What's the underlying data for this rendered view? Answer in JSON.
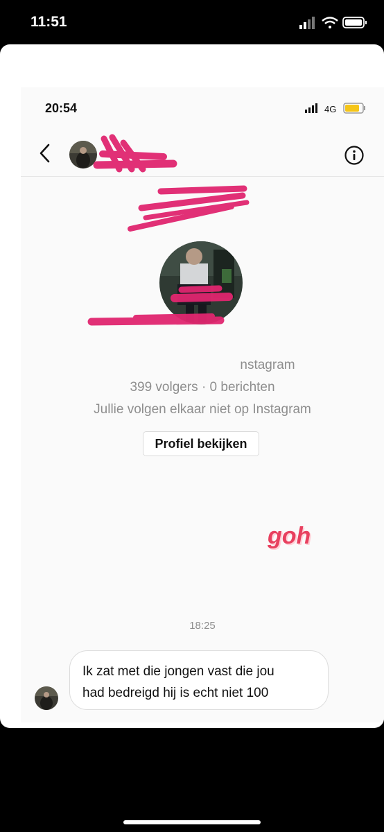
{
  "outer_status": {
    "time": "11:51"
  },
  "inner_status": {
    "time": "20:54",
    "network": "4G"
  },
  "header": {
    "back_icon": "chevron-left-icon",
    "info_icon": "info-icon"
  },
  "profile": {
    "source_text": "nstagram",
    "stats": "399 volgers · 0 berichten",
    "relation": "Jullie volgen elkaar niet op Instagram",
    "view_button": "Profiel bekijken"
  },
  "sticker_text": "goh",
  "conversation": {
    "timestamp": "18:25",
    "messages": [
      {
        "line1": "Ik zat met die jongen vast die jou",
        "line2": "had bedreigd hij is echt niet 100"
      }
    ]
  },
  "colors": {
    "redaction": "#e0266f",
    "battery": "#f5c518",
    "accent": "#e8405f"
  }
}
